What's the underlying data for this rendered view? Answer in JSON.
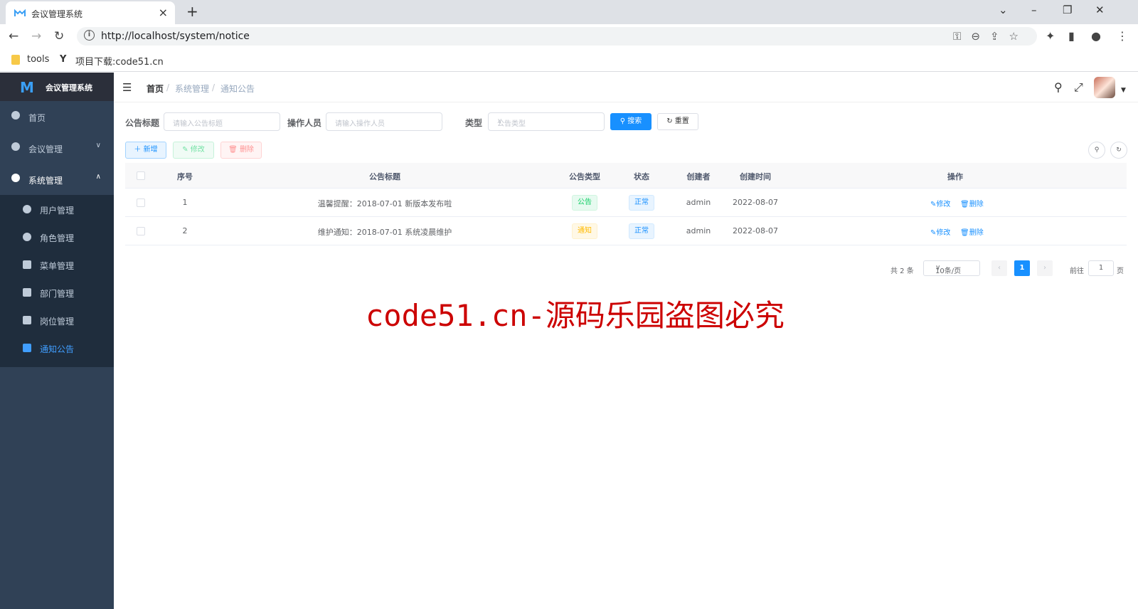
{
  "browser": {
    "tab_title": "会议管理系统",
    "url": "http://localhost/system/notice",
    "bookmarks": [
      "tools",
      "项目下载:code51.cn"
    ]
  },
  "sidebar": {
    "logo_text": "会议管理系统",
    "items": [
      {
        "label": "首页",
        "icon": "dashboard-icon"
      },
      {
        "label": "会议管理",
        "icon": "globe-icon"
      },
      {
        "label": "系统管理",
        "icon": "gear-icon"
      }
    ],
    "sub_items": [
      {
        "label": "用户管理",
        "icon": "user-icon"
      },
      {
        "label": "角色管理",
        "icon": "people-icon"
      },
      {
        "label": "菜单管理",
        "icon": "tree-table-icon"
      },
      {
        "label": "部门管理",
        "icon": "org-tree-icon"
      },
      {
        "label": "岗位管理",
        "icon": "post-icon"
      },
      {
        "label": "通知公告",
        "icon": "message-icon"
      }
    ],
    "active_color": "#409eff"
  },
  "breadcrumb": [
    "首页",
    "系统管理",
    "通知公告"
  ],
  "search": {
    "title_label": "公告标题",
    "title_placeholder": "请输入公告标题",
    "operator_label": "操作人员",
    "operator_placeholder": "请输入操作人员",
    "type_label": "类型",
    "type_placeholder": "公告类型",
    "search_btn": "搜索",
    "reset_btn": "重置"
  },
  "toolbar": {
    "add": "新增",
    "edit": "修改",
    "delete": "删除"
  },
  "table": {
    "headers": [
      "序号",
      "公告标题",
      "公告类型",
      "状态",
      "创建者",
      "创建时间",
      "操作"
    ],
    "rows": [
      {
        "id": "1",
        "title": "温馨提醒：2018-07-01 新版本发布啦",
        "type": "公告",
        "status": "正常",
        "creator": "admin",
        "time": "2022-08-07",
        "edit": "修改",
        "delete": "删除"
      },
      {
        "id": "2",
        "title": "维护通知：2018-07-01 系统凌晨维护",
        "type": "通知",
        "status": "正常",
        "creator": "admin",
        "time": "2022-08-07",
        "edit": "修改",
        "delete": "删除"
      }
    ]
  },
  "pagination": {
    "total": "共 2 条",
    "page_size": "10条/页",
    "current": "1",
    "goto_prefix": "前往",
    "goto_value": "1",
    "goto_suffix": "页"
  },
  "watermark": "code51.cn-源码乐园盗图必究",
  "colors": {
    "primary": "#1890ff",
    "sidebar_bg": "#304156",
    "submenu_bg": "#1f2d3d",
    "watermark": "#cc0000"
  }
}
